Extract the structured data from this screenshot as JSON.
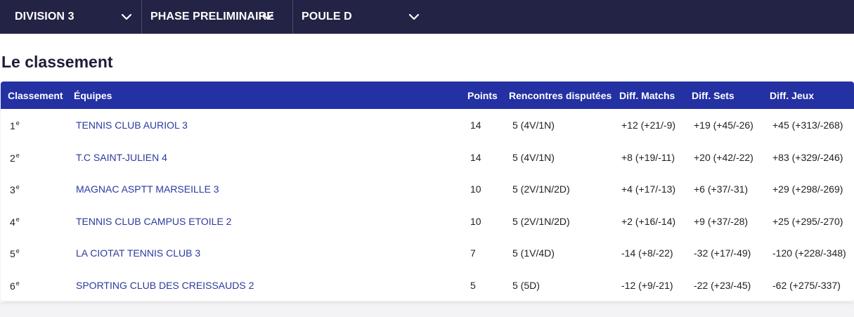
{
  "filters": {
    "division": "DIVISION 3",
    "phase": "PHASE PRELIMINAIRE",
    "poule": "POULE D"
  },
  "section_title": "Le classement",
  "table": {
    "headers": {
      "rank": "Classement",
      "team": "Équipes",
      "points": "Points",
      "played": "Rencontres disputées",
      "diff_matchs": "Diff. Matchs",
      "diff_sets": "Diff. Sets",
      "diff_jeux": "Diff. Jeux"
    },
    "rank_suffix": "e",
    "rows": [
      {
        "rank": "1",
        "team": "TENNIS CLUB AURIOL 3",
        "points": "14",
        "played": "5 (4V/1N)",
        "diff_matchs": "+12 (+21/-9)",
        "diff_sets": "+19 (+45/-26)",
        "diff_jeux": "+45 (+313/-268)"
      },
      {
        "rank": "2",
        "team": "T.C SAINT-JULIEN 4",
        "points": "14",
        "played": "5 (4V/1N)",
        "diff_matchs": "+8 (+19/-11)",
        "diff_sets": "+20 (+42/-22)",
        "diff_jeux": "+83 (+329/-246)"
      },
      {
        "rank": "3",
        "team": "MAGNAC ASPTT MARSEILLE 3",
        "points": "10",
        "played": "5 (2V/1N/2D)",
        "diff_matchs": "+4 (+17/-13)",
        "diff_sets": "+6 (+37/-31)",
        "diff_jeux": "+29 (+298/-269)"
      },
      {
        "rank": "4",
        "team": "TENNIS CLUB CAMPUS ETOILE 2",
        "points": "10",
        "played": "5 (2V/1N/2D)",
        "diff_matchs": "+2 (+16/-14)",
        "diff_sets": "+9 (+37/-28)",
        "diff_jeux": "+25 (+295/-270)"
      },
      {
        "rank": "5",
        "team": "LA CIOTAT TENNIS CLUB 3",
        "points": "7",
        "played": "5 (1V/4D)",
        "diff_matchs": "-14 (+8/-22)",
        "diff_sets": "-32 (+17/-49)",
        "diff_jeux": "-120 (+228/-348)"
      },
      {
        "rank": "6",
        "team": "SPORTING CLUB DES CREISSAUDS 2",
        "points": "5",
        "played": "5 (5D)",
        "diff_matchs": "-12 (+9/-21)",
        "diff_sets": "-22 (+23/-45)",
        "diff_jeux": "-62 (+275/-337)"
      }
    ]
  },
  "icons": {
    "dropdown": "chevron-down-icon"
  },
  "colors": {
    "topbar": "#232345",
    "header": "#2431a3",
    "link": "#2b3a9e"
  }
}
